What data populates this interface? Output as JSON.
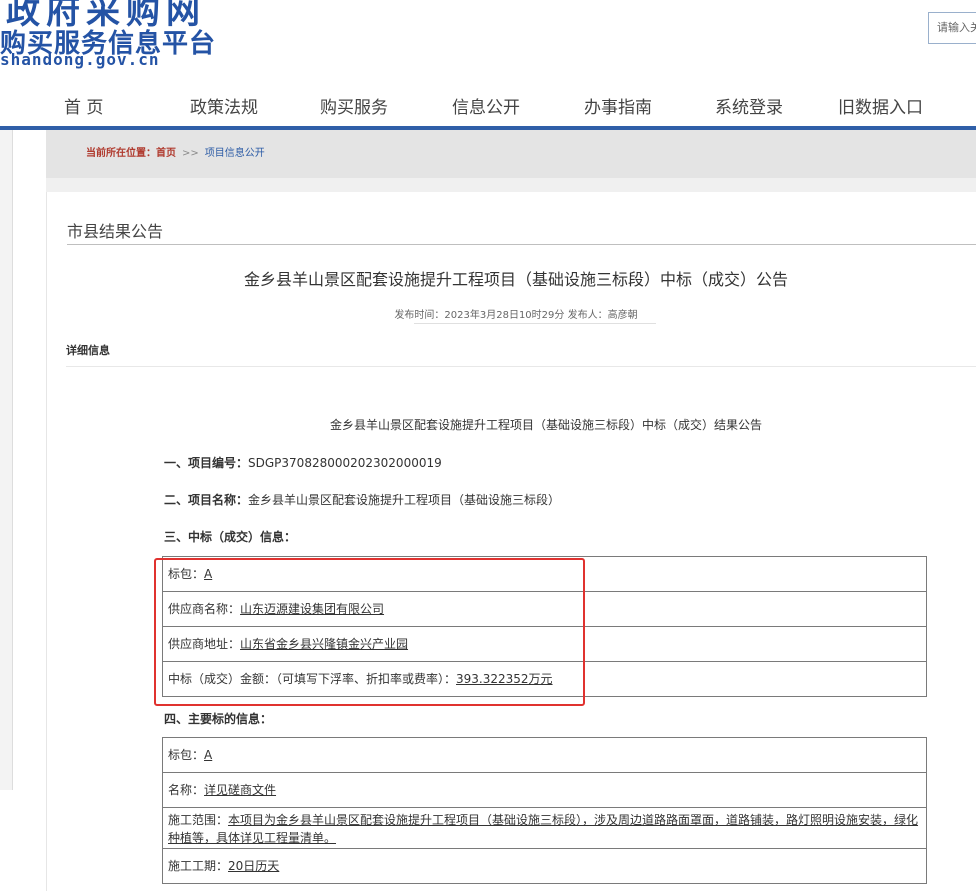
{
  "header": {
    "logo_line1": "政府采购网",
    "logo_line2": "购买服务信息平台",
    "logo_url": "shandong.gov.cn",
    "search_placeholder": "请输入关"
  },
  "nav": {
    "items": [
      "首 页",
      "政策法规",
      "购买服务",
      "信息公开",
      "办事指南",
      "系统登录",
      "旧数据入口"
    ]
  },
  "breadcrumb": {
    "label": "当前所在位置：",
    "home": "首页",
    "separator": ">>",
    "current": "项目信息公开"
  },
  "section": {
    "title": "市县结果公告"
  },
  "notice": {
    "title": "金乡县羊山景区配套设施提升工程项目（基础设施三标段）中标（成交）公告",
    "meta": "发布时间：2023年3月28日10时29分   发布人：高彦朝"
  },
  "detail": {
    "label": "详细信息",
    "doc_title": "金乡县羊山景区配套设施提升工程项目（基础设施三标段）中标（成交）结果公告",
    "project_no_label": "一、项目编号：",
    "project_no": "SDGP370828000202302000019",
    "project_name_label": "二、项目名称：",
    "project_name": "金乡县羊山景区配套设施提升工程项目（基础设施三标段）",
    "award_info_label": "三、中标（成交）信息：",
    "award_rows": [
      {
        "label": "标包：",
        "value": "A"
      },
      {
        "label": "供应商名称：",
        "value": "山东迈源建设集团有限公司"
      },
      {
        "label": "供应商地址：",
        "value": "山东省金乡县兴隆镇金兴产业园"
      },
      {
        "label": "中标（成交）金额：（可填写下浮率、折扣率或费率）：",
        "value": "393.322352万元"
      }
    ],
    "main_target_label": "四、主要标的信息：",
    "target_rows": [
      {
        "label": "标包：",
        "value": "A"
      },
      {
        "label": "名称：",
        "value": "详见磋商文件"
      },
      {
        "label": "施工范围：",
        "value": "本项目为金乡县羊山景区配套设施提升工程项目（基础设施三标段），涉及周边道路路面罩面，道路铺装，路灯照明设施安装，绿化种植等，具体详见工程量清单。"
      },
      {
        "label": "施工工期：",
        "value": "20日历天"
      }
    ]
  },
  "colors": {
    "brand_blue": "#2453a5",
    "nav_underline": "#2f5fa8",
    "highlight_red": "#e0322f"
  }
}
